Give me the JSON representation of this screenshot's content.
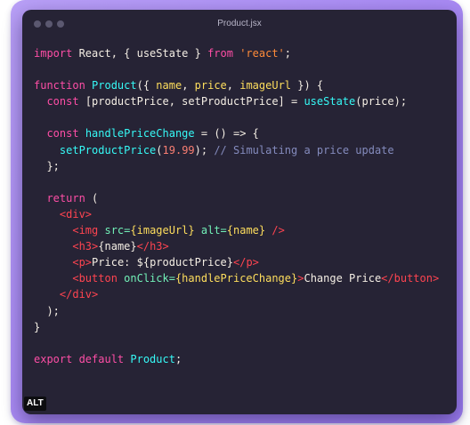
{
  "window": {
    "title": "Product.jsx"
  },
  "badge": {
    "label": "ALT"
  },
  "colors": {
    "background_gradient_start": "#b9a0f7",
    "background_gradient_end": "#9b7cef",
    "editor_background": "#262335",
    "keyword": "#fe4ea6",
    "function": "#36f9f6",
    "string": "#ff8b39",
    "variable": "#fede5d",
    "tag": "#fe4450",
    "attribute": "#72f1b8",
    "number": "#f97e72",
    "comment": "#848bbd",
    "text": "#f4eee4"
  },
  "code": {
    "language": "jsx",
    "lines": [
      [
        {
          "t": "kw",
          "v": "import "
        },
        {
          "t": "txt",
          "v": "React, { useState } "
        },
        {
          "t": "kw",
          "v": "from "
        },
        {
          "t": "str",
          "v": "'react'"
        },
        {
          "t": "txt",
          "v": ";"
        }
      ],
      [],
      [
        {
          "t": "kw",
          "v": "function "
        },
        {
          "t": "fn",
          "v": "Product"
        },
        {
          "t": "txt",
          "v": "({ "
        },
        {
          "t": "var",
          "v": "name"
        },
        {
          "t": "txt",
          "v": ", "
        },
        {
          "t": "var",
          "v": "price"
        },
        {
          "t": "txt",
          "v": ", "
        },
        {
          "t": "var",
          "v": "imageUrl"
        },
        {
          "t": "txt",
          "v": " }) {"
        }
      ],
      [
        {
          "t": "txt",
          "v": "  "
        },
        {
          "t": "kw",
          "v": "const "
        },
        {
          "t": "txt",
          "v": "[productPrice, setProductPrice] = "
        },
        {
          "t": "fn",
          "v": "useState"
        },
        {
          "t": "txt",
          "v": "(price);"
        }
      ],
      [],
      [
        {
          "t": "txt",
          "v": "  "
        },
        {
          "t": "kw",
          "v": "const "
        },
        {
          "t": "fn",
          "v": "handlePriceChange"
        },
        {
          "t": "txt",
          "v": " = () => {"
        }
      ],
      [
        {
          "t": "txt",
          "v": "    "
        },
        {
          "t": "fn",
          "v": "setProductPrice"
        },
        {
          "t": "txt",
          "v": "("
        },
        {
          "t": "num",
          "v": "19.99"
        },
        {
          "t": "txt",
          "v": "); "
        },
        {
          "t": "cm",
          "v": "// Simulating a price update"
        }
      ],
      [
        {
          "t": "txt",
          "v": "  };"
        }
      ],
      [],
      [
        {
          "t": "txt",
          "v": "  "
        },
        {
          "t": "kw",
          "v": "return "
        },
        {
          "t": "txt",
          "v": "("
        }
      ],
      [
        {
          "t": "txt",
          "v": "    "
        },
        {
          "t": "tag",
          "v": "<div>"
        }
      ],
      [
        {
          "t": "txt",
          "v": "      "
        },
        {
          "t": "tag",
          "v": "<img "
        },
        {
          "t": "attr",
          "v": "src="
        },
        {
          "t": "var",
          "v": "{imageUrl}"
        },
        {
          "t": "txt",
          "v": " "
        },
        {
          "t": "attr",
          "v": "alt="
        },
        {
          "t": "var",
          "v": "{name}"
        },
        {
          "t": "tag",
          "v": " />"
        }
      ],
      [
        {
          "t": "txt",
          "v": "      "
        },
        {
          "t": "tag",
          "v": "<h3>"
        },
        {
          "t": "txt",
          "v": "{name}"
        },
        {
          "t": "tag",
          "v": "</h3>"
        }
      ],
      [
        {
          "t": "txt",
          "v": "      "
        },
        {
          "t": "tag",
          "v": "<p>"
        },
        {
          "t": "txt",
          "v": "Price: ${productPrice}"
        },
        {
          "t": "tag",
          "v": "</p>"
        }
      ],
      [
        {
          "t": "txt",
          "v": "      "
        },
        {
          "t": "tag",
          "v": "<button "
        },
        {
          "t": "attr",
          "v": "onClick="
        },
        {
          "t": "var",
          "v": "{handlePriceChange}"
        },
        {
          "t": "tag",
          "v": ">"
        },
        {
          "t": "txt",
          "v": "Change Price"
        },
        {
          "t": "tag",
          "v": "</button>"
        }
      ],
      [
        {
          "t": "txt",
          "v": "    "
        },
        {
          "t": "tag",
          "v": "</div>"
        }
      ],
      [
        {
          "t": "txt",
          "v": "  );"
        }
      ],
      [
        {
          "t": "txt",
          "v": "}"
        }
      ],
      [],
      [
        {
          "t": "kw",
          "v": "export "
        },
        {
          "t": "kw",
          "v": "default "
        },
        {
          "t": "fn",
          "v": "Product"
        },
        {
          "t": "txt",
          "v": ";"
        }
      ]
    ]
  }
}
